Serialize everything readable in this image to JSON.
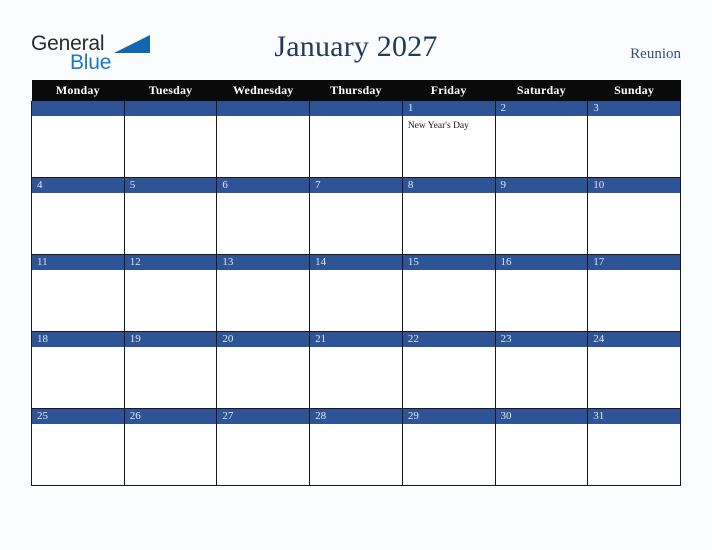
{
  "brand": {
    "name_part1": "General",
    "name_part2": "Blue",
    "color_dark": "#2b2b2b",
    "color_blue": "#1b7ac4",
    "triangle_color": "#1168b0"
  },
  "header": {
    "title": "January 2027",
    "region": "Reunion",
    "title_color": "#23395d",
    "region_color": "#39507a"
  },
  "calendar": {
    "header_bg": "#0a0a0a",
    "header_text_color": "#ffffff",
    "daynum_bg": "#2e5496",
    "daynum_text_color": "#dfe5f0",
    "cell_bg": "#ffffff",
    "border_color": "#1a1a1a",
    "weekday_headers": [
      "Monday",
      "Tuesday",
      "Wednesday",
      "Thursday",
      "Friday",
      "Saturday",
      "Sunday"
    ],
    "weeks": [
      [
        {
          "day": "",
          "events": []
        },
        {
          "day": "",
          "events": []
        },
        {
          "day": "",
          "events": []
        },
        {
          "day": "",
          "events": []
        },
        {
          "day": "1",
          "events": [
            "New Year's Day"
          ]
        },
        {
          "day": "2",
          "events": []
        },
        {
          "day": "3",
          "events": []
        }
      ],
      [
        {
          "day": "4",
          "events": []
        },
        {
          "day": "5",
          "events": []
        },
        {
          "day": "6",
          "events": []
        },
        {
          "day": "7",
          "events": []
        },
        {
          "day": "8",
          "events": []
        },
        {
          "day": "9",
          "events": []
        },
        {
          "day": "10",
          "events": []
        }
      ],
      [
        {
          "day": "11",
          "events": []
        },
        {
          "day": "12",
          "events": []
        },
        {
          "day": "13",
          "events": []
        },
        {
          "day": "14",
          "events": []
        },
        {
          "day": "15",
          "events": []
        },
        {
          "day": "16",
          "events": []
        },
        {
          "day": "17",
          "events": []
        }
      ],
      [
        {
          "day": "18",
          "events": []
        },
        {
          "day": "19",
          "events": []
        },
        {
          "day": "20",
          "events": []
        },
        {
          "day": "21",
          "events": []
        },
        {
          "day": "22",
          "events": []
        },
        {
          "day": "23",
          "events": []
        },
        {
          "day": "24",
          "events": []
        }
      ],
      [
        {
          "day": "25",
          "events": []
        },
        {
          "day": "26",
          "events": []
        },
        {
          "day": "27",
          "events": []
        },
        {
          "day": "28",
          "events": []
        },
        {
          "day": "29",
          "events": []
        },
        {
          "day": "30",
          "events": []
        },
        {
          "day": "31",
          "events": []
        }
      ]
    ]
  }
}
